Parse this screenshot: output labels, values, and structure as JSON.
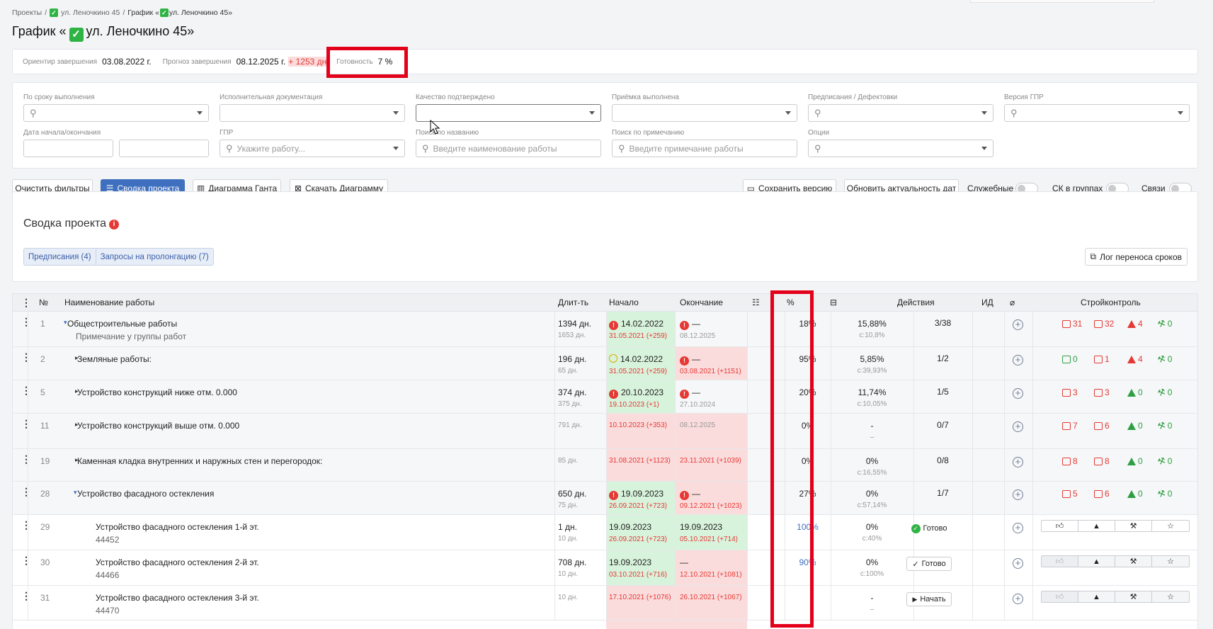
{
  "breadcrumb": {
    "root": "Проекты",
    "project": "ул. Леночкино 45",
    "current": "График «",
    "current_tail": "ул. Леночкино 45»"
  },
  "page_title": {
    "prefix": "График «",
    "suffix": "ул. Леночкино 45»"
  },
  "status_bar": {
    "target_label": "Ориентир завершения",
    "target_value": "03.08.2022 г.",
    "forecast_label": "Прогноз завершения",
    "forecast_value": "08.12.2025 г.",
    "forecast_delta": "+ 1253 дн",
    "ready_label": "Готовность",
    "ready_value": "7 %"
  },
  "filters": {
    "by_deadline": "По сроку выполнения",
    "exec_docs": "Исполнительная документация",
    "quality": "Качество подтверждено",
    "acceptance": "Приёмка выполнена",
    "prescriptions": "Предписания / Дефектовки",
    "gpr_version": "Версия ГПР",
    "dates": "Дата начала/окончания",
    "gpr": "ГПР",
    "gpr_placeholder": "Укажите работу...",
    "search_name": "Поиск по названию",
    "search_name_placeholder": "Введите наименование работы",
    "search_note": "Поиск по примечанию",
    "search_note_placeholder": "Введите примечание работы",
    "options": "Опции"
  },
  "toolbar": {
    "clear": "Очистить фильтры",
    "summary": "Сводка проекта",
    "gantt": "Диаграмма Ганта",
    "download": "Скачать Диаграмму",
    "save_version": "Сохранить версию",
    "refresh_dates": "Обновить актуальность дат",
    "service": "Служебные",
    "sk_groups": "СК в группах",
    "links": "Связи"
  },
  "summary": {
    "title": "Сводка проекта",
    "tab_prescriptions": "Предписания (4)",
    "tab_extension": "Запросы на пролонгацию (7)",
    "log_button": "Лог переноса сроков"
  },
  "table": {
    "headers": {
      "num": "№",
      "name": "Наименование работы",
      "dur": "Длит-ть",
      "start": "Начало",
      "end": "Окончание",
      "pct": "%",
      "actions": "Действия",
      "id": "ИД",
      "sk": "Стройконтроль"
    },
    "rows": [
      {
        "num": "1",
        "name": "Общестроительные работы",
        "note": "Примечание у группы работ",
        "dur": "1394 дн.",
        "dur2": "1653 дн.",
        "start": "14.02.2022",
        "start2": "31.05.2021 (+259)",
        "end": "—",
        "end2": "08.12.2025",
        "pct": "18%",
        "share": "15,88%",
        "share2": "с:10,8%",
        "act": "3/38",
        "sk": [
          "31",
          "32",
          "4",
          "0"
        ]
      },
      {
        "num": "2",
        "name": "Земляные работы:",
        "dur": "196 дн.",
        "dur2": "65 дн.",
        "start": "14.02.2022",
        "start2": "31.05.2021 (+259)",
        "end": "—",
        "end2": "03.08.2021 (+1151)",
        "pct": "95%",
        "share": "5,85%",
        "share2": "с:39,93%",
        "act": "1/2",
        "sk": [
          "0",
          "1",
          "4",
          "0"
        ]
      },
      {
        "num": "5",
        "name": "Устройство конструкций ниже отм. 0.000",
        "dur": "374 дн.",
        "dur2": "375 дн.",
        "start": "20.10.2023",
        "start2": "19.10.2023 (+1)",
        "end": "—",
        "end2": "27.10.2024",
        "pct": "20%",
        "share": "11,74%",
        "share2": "с:10,05%",
        "act": "1/5",
        "sk": [
          "3",
          "3",
          "0",
          "0"
        ]
      },
      {
        "num": "11",
        "name": "Устройство конструкций выше отм. 0.000",
        "dur2": "791 дн.",
        "start2": "10.10.2023 (+353)",
        "end2": "08.12.2025",
        "pct": "0%",
        "share": "-",
        "share2": "–",
        "act": "0/7",
        "sk": [
          "7",
          "6",
          "0",
          "0"
        ]
      },
      {
        "num": "19",
        "name": "Каменная кладка внутренних и наружных стен и перегородок:",
        "dur2": "85 дн.",
        "start2": "31.08.2021 (+1123)",
        "end2": "23.11.2021 (+1039)",
        "pct": "0%",
        "share": "0%",
        "share2": "с:16,55%",
        "act": "0/8",
        "sk": [
          "8",
          "8",
          "0",
          "0"
        ]
      },
      {
        "num": "28",
        "name": "Устройство фасадного остекления",
        "dur": "650 дн.",
        "dur2": "75 дн.",
        "start": "19.09.2023",
        "start2": "26.09.2021 (+723)",
        "end": "—",
        "end2": "09.12.2021 (+1023)",
        "pct": "27%",
        "share": "0%",
        "share2": "с:57,14%",
        "act": "1/7",
        "sk": [
          "5",
          "6",
          "0",
          "0"
        ]
      },
      {
        "num": "29",
        "name": "Устройство фасадного остекления 1-й эт.",
        "code": "44452",
        "dur": "1 дн.",
        "dur2": "10 дн.",
        "start": "19.09.2023",
        "start2": "26.09.2021 (+723)",
        "end": "19.09.2023",
        "end2": "05.10.2021 (+714)",
        "pct": "100%",
        "share": "0%",
        "share2": "с:40%",
        "act": "Готово"
      },
      {
        "num": "30",
        "name": "Устройство фасадного остекления 2-й эт.",
        "code": "44466",
        "dur": "708 дн.",
        "dur2": "10 дн.",
        "start": "19.09.2023",
        "start2": "03.10.2021 (+716)",
        "end": "—",
        "end2": "12.10.2021 (+1081)",
        "pct": "90%",
        "share": "0%",
        "share2": "с:100%",
        "act": "Готово"
      },
      {
        "num": "31",
        "name": "Устройство фасадного остекления 3-й эт.",
        "code": "44470",
        "dur2": "10 дн.",
        "start2": "17.10.2021 (+1076)",
        "end2": "26.10.2021 (+1067)",
        "share": "-",
        "share2": "–",
        "act": "Начать"
      }
    ]
  }
}
